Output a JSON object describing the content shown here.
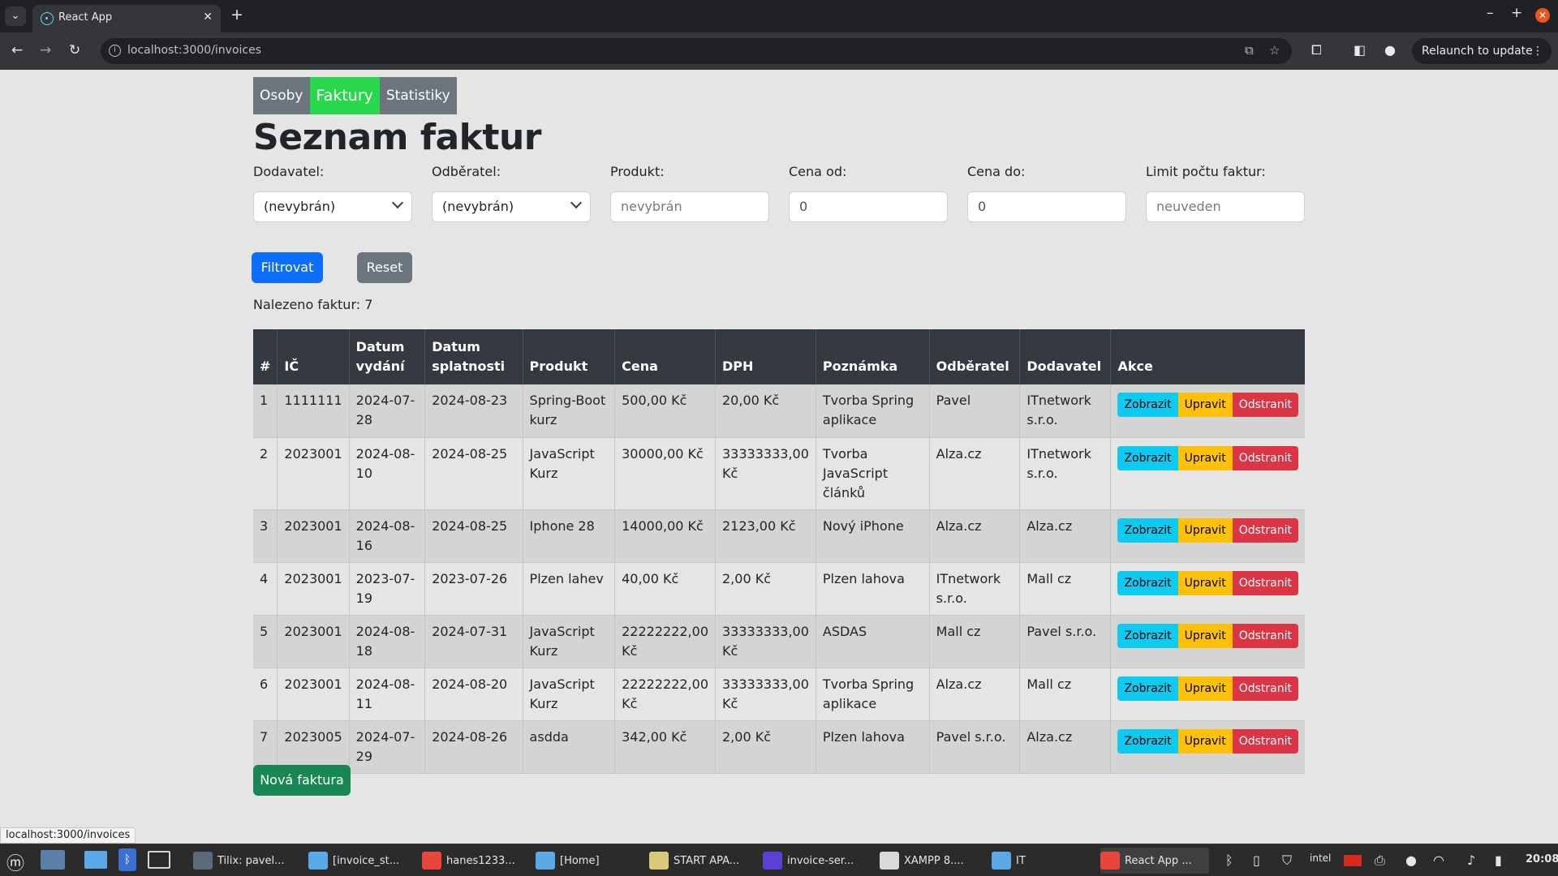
{
  "browser": {
    "tab_title": "React App",
    "url": "localhost:3000/invoices",
    "relaunch_label": "Relaunch to update",
    "status_url": "localhost:3000/invoices"
  },
  "nav": {
    "items": [
      {
        "label": "Osoby",
        "active": false
      },
      {
        "label": "Faktury",
        "active": true
      },
      {
        "label": "Statistiky",
        "active": false
      }
    ]
  },
  "page": {
    "title": "Seznam faktur",
    "filters": {
      "supplier": {
        "label": "Dodavatel:",
        "value": "(nevybrán)"
      },
      "buyer": {
        "label": "Odběratel:",
        "value": "(nevybrán)"
      },
      "product": {
        "label": "Produkt:",
        "placeholder": "nevybrán"
      },
      "price_from": {
        "label": "Cena od:",
        "value": "0"
      },
      "price_to": {
        "label": "Cena do:",
        "value": "0"
      },
      "limit": {
        "label": "Limit počtu faktur:",
        "placeholder": "neuveden"
      }
    },
    "filter_button": "Filtrovat",
    "reset_button": "Reset",
    "found_text": "Nalezeno faktur: 7",
    "new_invoice_button": "Nová faktura"
  },
  "table": {
    "headers": [
      "#",
      "IČ",
      "Datum vydání",
      "Datum splatnosti",
      "Produkt",
      "Cena",
      "DPH",
      "Poznámka",
      "Odběratel",
      "Dodavatel",
      "Akce"
    ],
    "action_labels": {
      "view": "Zobrazit",
      "edit": "Upravit",
      "delete": "Odstranit"
    },
    "rows": [
      {
        "num": "1",
        "ic": "1111111",
        "issued": "2024-07-28",
        "due": "2024-08-23",
        "product": "Spring-Boot kurz",
        "price": "500,00 Kč",
        "vat": "20,00 Kč",
        "note": "Tvorba Spring aplikace",
        "buyer": "Pavel",
        "seller": "ITnetwork s.r.o."
      },
      {
        "num": "2",
        "ic": "2023001",
        "issued": "2024-08-10",
        "due": "2024-08-25",
        "product": "JavaScript Kurz",
        "price": "30000,00 Kč",
        "vat": "33333333,00 Kč",
        "note": "Tvorba JavaScript článků",
        "buyer": "Alza.cz",
        "seller": "ITnetwork s.r.o."
      },
      {
        "num": "3",
        "ic": "2023001",
        "issued": "2024-08-16",
        "due": "2024-08-25",
        "product": "Iphone 28",
        "price": "14000,00 Kč",
        "vat": "2123,00 Kč",
        "note": "Nový iPhone",
        "buyer": "Alza.cz",
        "seller": "Alza.cz"
      },
      {
        "num": "4",
        "ic": "2023001",
        "issued": "2023-07-19",
        "due": "2023-07-26",
        "product": "Plzen lahev",
        "price": "40,00 Kč",
        "vat": "2,00 Kč",
        "note": "Plzen lahova",
        "buyer": "ITnetwork s.r.o.",
        "seller": "Mall cz"
      },
      {
        "num": "5",
        "ic": "2023001",
        "issued": "2024-08-18",
        "due": "2024-07-31",
        "product": "JavaScript Kurz",
        "price": "22222222,00 Kč",
        "vat": "33333333,00 Kč",
        "note": "ASDAS",
        "buyer": "Mall cz",
        "seller": "Pavel s.r.o."
      },
      {
        "num": "6",
        "ic": "2023001",
        "issued": "2024-08-11",
        "due": "2024-08-20",
        "product": "JavaScript Kurz",
        "price": "22222222,00 Kč",
        "vat": "33333333,00 Kč",
        "note": "Tvorba Spring aplikace",
        "buyer": "Alza.cz",
        "seller": "Mall cz"
      },
      {
        "num": "7",
        "ic": "2023005",
        "issued": "2024-07-29",
        "due": "2024-08-26",
        "product": "asdda",
        "price": "342,00 Kč",
        "vat": "2,00 Kč",
        "note": "Plzen lahova",
        "buyer": "Pavel s.r.o.",
        "seller": "Alza.cz"
      }
    ]
  },
  "taskbar": {
    "items": [
      {
        "label": "Tilix: pavel...",
        "icon": "terminal-icon",
        "color": "#5b6b7a"
      },
      {
        "label": "[invoice_st...",
        "icon": "folder-icon",
        "color": "#5aa9e6"
      },
      {
        "label": "hanes1233...",
        "icon": "chrome-icon",
        "color": "#e8453c"
      },
      {
        "label": "[Home]",
        "icon": "folder-icon",
        "color": "#5aa9e6"
      },
      {
        "label": "START APA...",
        "icon": "text-editor-icon",
        "color": "#d9c77a"
      },
      {
        "label": "invoice-ser...",
        "icon": "intellij-icon",
        "color": "#5b3fd6"
      },
      {
        "label": "XAMPP 8....",
        "icon": "xampp-icon",
        "color": "#d9d9d9"
      },
      {
        "label": "IT",
        "icon": "folder-icon",
        "color": "#5aa9e6"
      },
      {
        "label": "React App ...",
        "icon": "chrome-icon",
        "color": "#e8453c"
      }
    ],
    "clock": "20:08"
  }
}
